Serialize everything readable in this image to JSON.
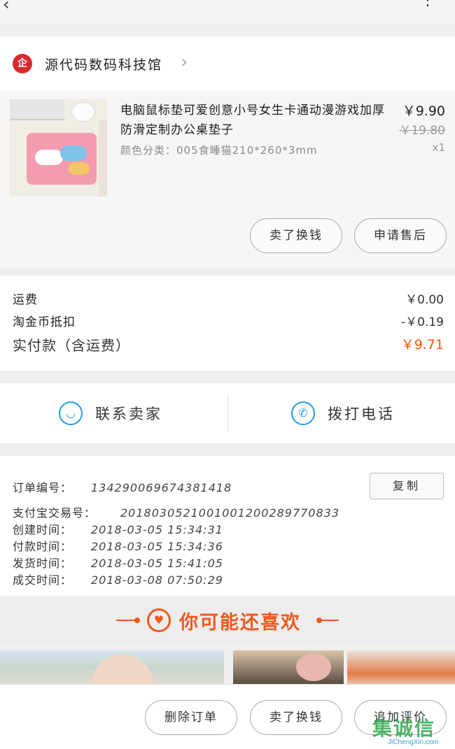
{
  "shop": {
    "logo_text": "企",
    "name": "源代码数码科技馆",
    "chevron": "›"
  },
  "product": {
    "title": "电脑鼠标垫可爱创意小号女生卡通动漫游戏加厚防滑定制办公桌垫子",
    "sku": "颜色分类：005食睡猫210*260*3mm",
    "price": "￥9.90",
    "original_price": "￥19.80",
    "quantity": "x1",
    "buttons": [
      "卖了换钱",
      "申请售后"
    ]
  },
  "fees": [
    {
      "label": "运费",
      "value": "￥0.00"
    },
    {
      "label": "淘金币抵扣",
      "value": "-￥0.19"
    },
    {
      "label": "实付款（含运费）",
      "value": "￥9.71"
    }
  ],
  "contact": {
    "seller_label": "联系卖家",
    "call_label": "拨打电话",
    "seller_icon": "chat-face-icon",
    "call_icon": "phone-icon"
  },
  "order_info": {
    "copy_label": "复制",
    "lines": [
      {
        "key": "订单编号：",
        "value": "134290069674381418"
      },
      {
        "key": "支付宝交易号：",
        "value": "2018030521001001200289770833"
      },
      {
        "key": "创建时间：",
        "value": "2018-03-05  15:34:31"
      },
      {
        "key": "付款时间：",
        "value": "2018-03-05  15:34:36"
      },
      {
        "key": "发货时间：",
        "value": "2018-03-05  15:41:05"
      },
      {
        "key": "成交时间：",
        "value": "2018-03-08  07:50:29"
      }
    ]
  },
  "recommend": {
    "title": "你可能还喜欢",
    "icon": "heart-icon"
  },
  "bottom_bar": {
    "buttons": [
      "删除订单",
      "卖了换钱",
      "追加评价"
    ]
  },
  "watermark": {
    "main": "集诚信",
    "sub": "JiChengXin.com"
  },
  "colors": {
    "accent": "#ff5000",
    "blue": "#1e9fe6",
    "recommend": "#f2591b"
  }
}
